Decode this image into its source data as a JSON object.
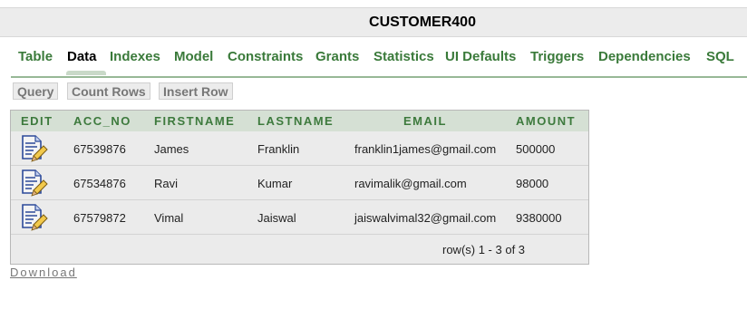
{
  "page": {
    "title": "CUSTOMER400"
  },
  "tabs": [
    {
      "label": "Table"
    },
    {
      "label": "Data",
      "active": true
    },
    {
      "label": "Indexes"
    },
    {
      "label": "Model"
    },
    {
      "label": "Constraints"
    },
    {
      "label": "Grants"
    },
    {
      "label": "Statistics"
    },
    {
      "label": "UI Defaults"
    },
    {
      "label": "Triggers"
    },
    {
      "label": "Dependencies"
    },
    {
      "label": "SQL"
    }
  ],
  "toolbar": {
    "query_label": "Query",
    "count_rows_label": "Count Rows",
    "insert_row_label": "Insert Row"
  },
  "grid": {
    "columns": [
      "EDIT",
      "ACC_NO",
      "FIRSTNAME",
      "LASTNAME",
      "EMAIL",
      "AMOUNT"
    ],
    "rows": [
      {
        "edit_icon": "edit-document-icon",
        "acc_no": "67539876",
        "firstname": "James",
        "lastname": "Franklin",
        "email": "franklin1james@gmail.com",
        "amount": "500000"
      },
      {
        "edit_icon": "edit-document-icon",
        "acc_no": "67534876",
        "firstname": "Ravi",
        "lastname": "Kumar",
        "email": "ravimalik@gmail.com",
        "amount": "98000"
      },
      {
        "edit_icon": "edit-document-icon",
        "acc_no": "67579872",
        "firstname": "Vimal",
        "lastname": "Jaiswal",
        "email": "jaiswalvimal32@gmail.com",
        "amount": "9380000"
      }
    ],
    "footer": "row(s) 1 - 3 of 3"
  },
  "download_label": "Download",
  "colors": {
    "tab_green": "#3a7a3a",
    "header_bg": "#d5e0d4",
    "grid_bg": "#ebebeb"
  }
}
